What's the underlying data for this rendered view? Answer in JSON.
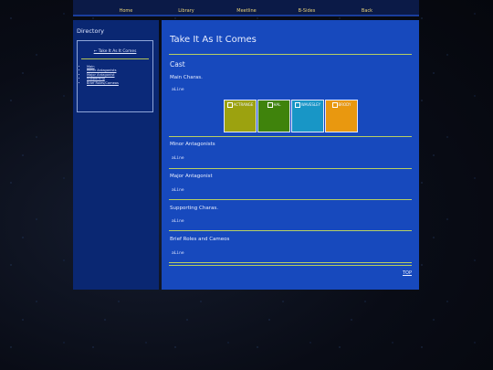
{
  "nav": {
    "items": [
      "Home",
      "Library",
      "Meetline",
      "B-Sides",
      "Back"
    ]
  },
  "sidebar": {
    "title": "Directory",
    "back_link": "← Take It As It Comes",
    "links": [
      "Main",
      "Minor Antagonists",
      "Major Antagonist",
      "Supporting",
      "Brief Roles/Cameos"
    ]
  },
  "main": {
    "page_title": "Take It As It Comes",
    "section_title": "Cast",
    "main_charas": {
      "heading": "Main Charas.",
      "code": "aLine",
      "cards": [
        {
          "label": "ACTRANGE",
          "color": "#9ca20f"
        },
        {
          "label": "HAL",
          "color": "#3f830c"
        },
        {
          "label": "WAVESLEY",
          "color": "#1896c6"
        },
        {
          "label": "BRODY",
          "color": "#e9980f"
        }
      ]
    },
    "minor_antagonists": {
      "heading": "Minor Antagonists",
      "code": "aLine"
    },
    "major_antagonist": {
      "heading": "Major Antagonist",
      "code": "aLine"
    },
    "supporting_charas": {
      "heading": "Supporting Charas.",
      "code": "aLine"
    },
    "brief_roles": {
      "heading": "Brief Roles and Cameos",
      "code": "aLine"
    },
    "top_link": "TOP"
  }
}
